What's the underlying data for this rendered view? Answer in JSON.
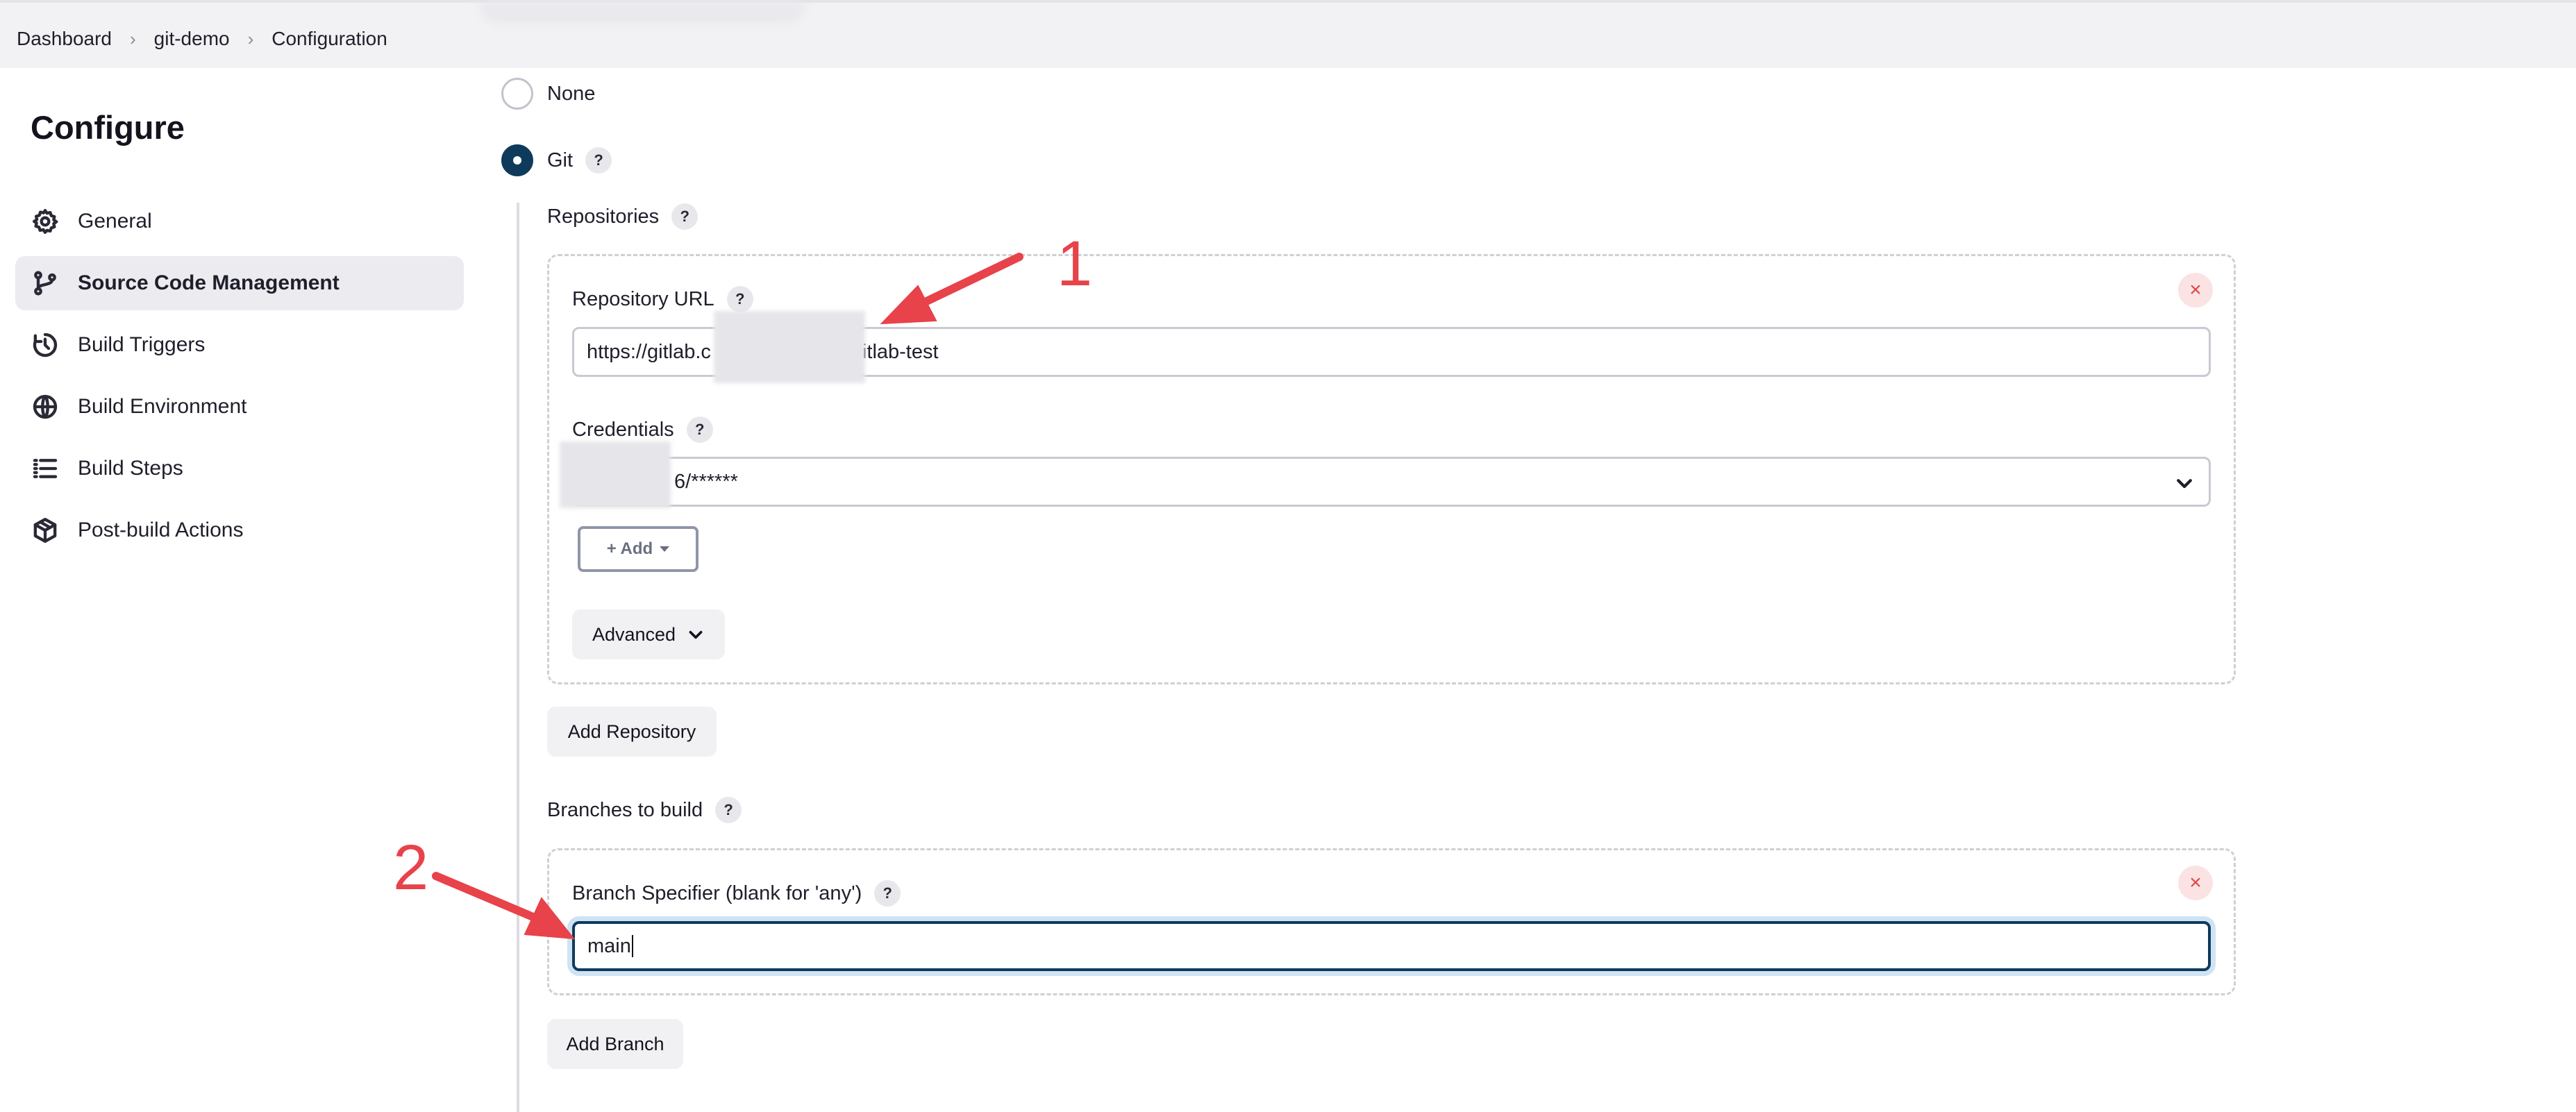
{
  "breadcrumb": [
    "Dashboard",
    "git-demo",
    "Configuration"
  ],
  "sidebar": {
    "title": "Configure",
    "items": [
      {
        "label": "General",
        "icon": "gear-icon",
        "active": false
      },
      {
        "label": "Source Code Management",
        "icon": "git-branch-icon",
        "active": true
      },
      {
        "label": "Build Triggers",
        "icon": "clock-icon",
        "active": false
      },
      {
        "label": "Build Environment",
        "icon": "globe-icon",
        "active": false
      },
      {
        "label": "Build Steps",
        "icon": "list-icon",
        "active": false
      },
      {
        "label": "Post-build Actions",
        "icon": "package-icon",
        "active": false
      }
    ]
  },
  "scm": {
    "option_none": "None",
    "option_git": "Git",
    "selected": "Git",
    "help_glyph": "?",
    "repositories_label": "Repositories",
    "repository_url_label": "Repository URL",
    "repository_url_value_start": "https://gitlab.c",
    "repository_url_value_end": "itlab-test",
    "credentials_label": "Credentials",
    "credentials_value": "6/******",
    "add_label": "+ Add",
    "advanced_label": "Advanced",
    "add_repository_label": "Add Repository",
    "branches_label": "Branches to build",
    "branch_specifier_label": "Branch Specifier (blank for 'any')",
    "branch_specifier_value": "main",
    "add_branch_label": "Add Branch",
    "remove_glyph": "×"
  },
  "annotations": [
    "1",
    "2"
  ],
  "colors": {
    "accent": "#0e3b5c",
    "annotation": "#e8424a",
    "remove": "#e0444a"
  }
}
